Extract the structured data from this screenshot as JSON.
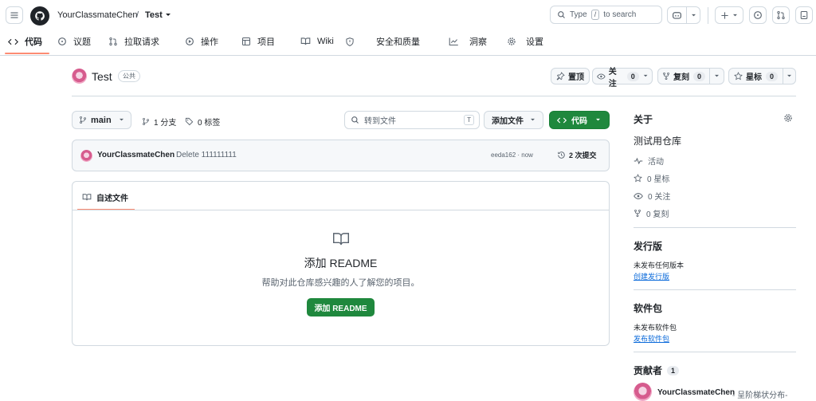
{
  "header": {
    "owner": "YourClassmateChen",
    "separator": "/",
    "repo": "Test",
    "search_placeholder_pre": "Type",
    "search_key": "/",
    "search_placeholder_post": "to search"
  },
  "tabs": [
    {
      "label": "代码",
      "icon": "code-icon"
    },
    {
      "label": "议题",
      "icon": "issue-icon"
    },
    {
      "label": "拉取请求",
      "icon": "pull-request-icon"
    },
    {
      "label": "操作",
      "icon": "play-icon"
    },
    {
      "label": "项目",
      "icon": "table-icon"
    },
    {
      "label": "Wiki",
      "icon": "book-icon"
    },
    {
      "label": "安全和质量",
      "icon": "shield-icon"
    },
    {
      "label": "洞察",
      "icon": "graph-icon"
    },
    {
      "label": "设置",
      "icon": "gear-icon"
    }
  ],
  "repo_header": {
    "name": "Test",
    "visibility": "公共",
    "pin_label": "置顶",
    "watch_label": "关注",
    "watch_count": "0",
    "fork_label": "复刻",
    "fork_count": "0",
    "star_label": "星标",
    "star_count": "0"
  },
  "file_nav": {
    "branch": "main",
    "branches": "1 分支",
    "tags": "0 标签",
    "goto_placeholder": "转到文件",
    "goto_key": "T",
    "add_file": "添加文件",
    "code_button": "代码"
  },
  "commit": {
    "author": "YourClassmateChen",
    "message": "Delete 111111111",
    "hash_time": "eeda162 · now",
    "commits": "2 次提交"
  },
  "readme": {
    "tab": "自述文件",
    "title": "添加 README",
    "description": "帮助对此仓库感兴趣的人了解您的项目。",
    "button": "添加 README"
  },
  "sidebar": {
    "about_title": "关于",
    "description": "测试用仓库",
    "activity": "活动",
    "stars": "0 星标",
    "watchers": "0 关注",
    "forks": "0 复刻",
    "releases_title": "发行版",
    "releases_empty": "未发布任何版本",
    "releases_link": "创建发行版",
    "packages_title": "软件包",
    "packages_empty": "未发布软件包",
    "packages_link": "发布软件包",
    "contributors_title": "贡献者",
    "contributors_count": "1",
    "contributor_name": "YourClassmateChen",
    "contributor_note": "- 呈阶梯状分布-"
  },
  "colors": {
    "accent": "#fd8c73",
    "primary_green": "#1f883d",
    "link_blue": "#0969da",
    "border": "#d1d9e0"
  }
}
